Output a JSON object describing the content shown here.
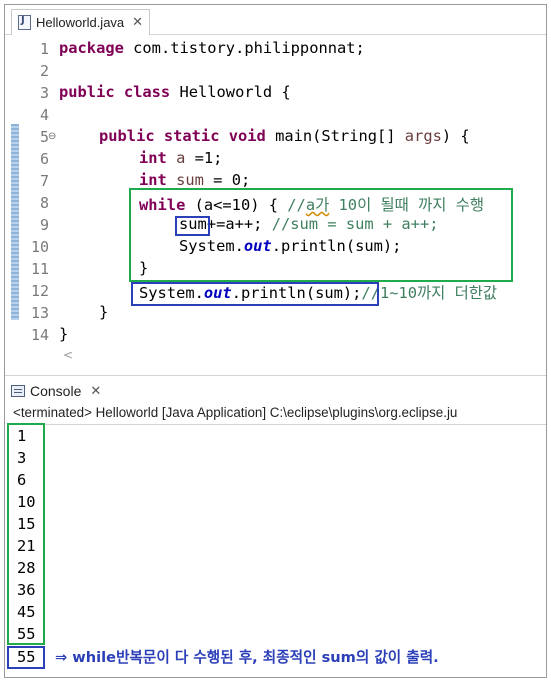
{
  "editor_tab": {
    "label": "Helloworld.java",
    "close": "✕"
  },
  "gutter": [
    "1",
    "2",
    "3",
    "4",
    "5",
    "6",
    "7",
    "8",
    "9",
    "10",
    "11",
    "12",
    "13",
    "14"
  ],
  "fold_marker": "⊖",
  "code": {
    "l1_kw": "package",
    "l1_rest": " com.tistory.philipponnat;",
    "l3_kw": "public class",
    "l3_rest": " Helloworld {",
    "l5_kw": "public static void",
    "l5_a": " main(String[] ",
    "l5_var": "args",
    "l5_b": ") {",
    "l6_kw": "int",
    "l6_var": " a",
    "l6_rest": " =1;",
    "l7_kw": "int",
    "l7_var": " sum",
    "l7_rest": " = 0;",
    "l8_kw": "while",
    "l8_a": " (a<=10) { ",
    "l8_cm_a": "//",
    "l8_cm_sq": "a가",
    "l8_cm_b": " 10이 될때 까지 수행",
    "l9_var": "sum",
    "l9_rest": "+=a++; ",
    "l9_cm": "//sum = sum + a++;",
    "l10_a": "System.",
    "l10_fld": "out",
    "l10_b": ".println(sum);",
    "l11": "}",
    "l12_a": "System.",
    "l12_fld": "out",
    "l12_b": ".println(sum);",
    "l12_cm": "//1~10까지 더한값",
    "l13": "}",
    "l14": "}"
  },
  "scroll_left": "<",
  "console_tab": {
    "label": "Console",
    "close": "✕"
  },
  "console_status": "<terminated> Helloworld [Java Application] C:\\eclipse\\plugins\\org.eclipse.ju",
  "output": [
    "1",
    "3",
    "6",
    "10",
    "15",
    "21",
    "28",
    "36",
    "45",
    "55"
  ],
  "final_output": "55",
  "note": "⇒ while반복문이 다 수행된 후, 최종적인 sum의 값이 출력.",
  "colors": {
    "keyword": "#7f0055",
    "comment": "#3f7f5f",
    "field": "#0000c0",
    "green_box": "#1faa4b",
    "blue_box": "#2b3fb8"
  }
}
